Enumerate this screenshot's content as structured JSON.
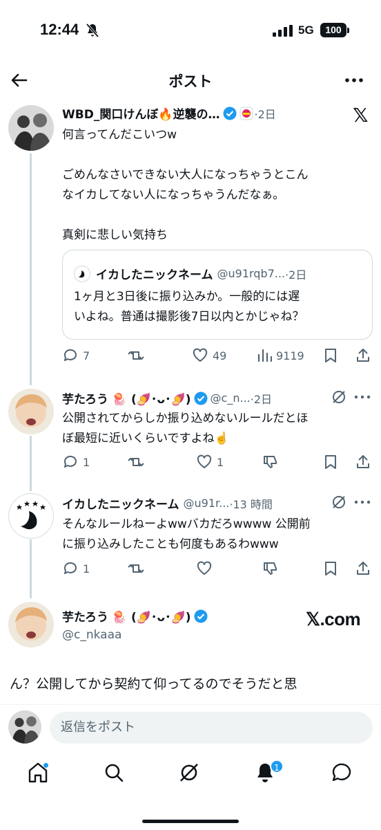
{
  "status": {
    "time": "12:44",
    "network": "5G",
    "battery": "100"
  },
  "header": {
    "title": "ポスト"
  },
  "post": {
    "name": "WBD_関口けんぼ🔥逆襲の…",
    "time": "·2日",
    "lines": [
      "何言ってんだこいつw",
      "",
      "ごめんなさいできない大人になっちゃうとこん",
      "なイカしてない人になっちゃうんだなぁ。",
      "",
      "真剣に悲しい気持ち"
    ],
    "quote": {
      "name": "イカしたニックネーム",
      "handle": "@u91rqb7...",
      "time": "·2日",
      "lines": [
        "1ヶ月と3日後に振り込みか。一般的には遅",
        "いよね。普通は撮影後7日以内とかじゃね？"
      ]
    },
    "stats": {
      "replies": "7",
      "likes": "49",
      "views": "9119"
    }
  },
  "reply1": {
    "name": "芋たろう 🪼 (🍠･ᴗ･🍠)",
    "handle": "@c_n...",
    "time": "·2日",
    "lines": [
      "公開されてからしか振り込めないルールだとほ",
      "ぼ最短に近いくらいですよね☝️"
    ],
    "stats": {
      "replies": "1",
      "likes": "1"
    }
  },
  "reply2": {
    "name": "イカしたニックネーム",
    "handle": "@u91r...",
    "time": "·13 時間",
    "lines": [
      "そんなルールねーよwwバカだろwwww 公開前",
      "に振り込みしたことも何度もあるわwww"
    ],
    "stats": {
      "replies": "1"
    }
  },
  "focused": {
    "name": "芋たろう 🪼 (🍠･ᴗ･🍠)",
    "handle": "@c_nkaaa",
    "text": "ん？公開してから契約て仰ってるのでそうだと思"
  },
  "watermark": "𝕏.com",
  "x_logo": "𝕏",
  "reply_placeholder": "返信をポスト",
  "notifications_badge": "1",
  "colors": {
    "accent": "#1d9bf0",
    "text": "#0f1419",
    "muted": "#536471",
    "border": "#cfd9de"
  }
}
